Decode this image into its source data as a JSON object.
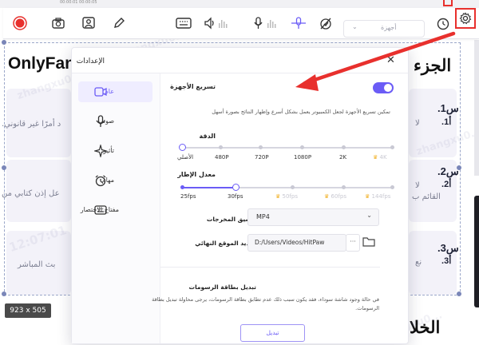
{
  "toolbar": {
    "time_display": "00:00:01  00:00:05",
    "icons": [
      "record-icon",
      "camera-icon",
      "webcam-icon",
      "pen-icon",
      "keyboard-icon",
      "speaker-icon",
      "microphone-icon",
      "wifi-mic-icon",
      "disable-icon",
      "timer-icon",
      "settings-icon"
    ],
    "device_select": {
      "value": "أجهزة",
      "caret": "⌄"
    },
    "colors": {
      "record": "#e8302d",
      "accent": "#6b5cf6"
    }
  },
  "background_page": {
    "heading_top_right": "الجزء",
    "heading_top_left": "OnlyFans",
    "heading_bottom_right": "الخلا",
    "cards_left": [
      "د أمرًا غير قانوني.",
      "عل إذن كتابي من",
      "بث المباشر"
    ],
    "questions": [
      {
        "q": "س1.",
        "a": "أ1.",
        "a_tail": "لا"
      },
      {
        "q": "س2.",
        "a": "أ2.",
        "a_tail": "لا",
        "extra": "القائم ب"
      },
      {
        "q": "س3.",
        "a": "أ3.",
        "a_tail": "نع"
      }
    ],
    "watermark": "zhangxu0...",
    "watermark_time": "12:07:01",
    "size_tag": "923 x 505"
  },
  "dialog": {
    "title": "الإعدادات",
    "close": "✕",
    "nav": [
      {
        "label": "عام",
        "icon": "video-icon",
        "active": true
      },
      {
        "label": "صوتي",
        "icon": "microphone-icon",
        "active": false
      },
      {
        "label": "تأثير",
        "icon": "sparkle-icon",
        "active": false
      },
      {
        "label": "مهام",
        "icon": "alarm-clock-icon",
        "active": false
      },
      {
        "label": "مفتاح الاختصار",
        "icon": "keyboard-icon",
        "active": false
      }
    ],
    "hw_accel": {
      "title": "تسريع الأجهزة",
      "enabled": true,
      "description": "تمكين تسريع الأجهزة لجعل الكمبيوتر يعمل بشكل أسرع وإظهار النتائج بصورة أسهل"
    },
    "resolution": {
      "title": "الدقة",
      "ticks": [
        "الأصلي",
        "480P",
        "720P",
        "1080P",
        "2K",
        "4K"
      ],
      "selected_index": 0,
      "pro_ticks": [
        "4K"
      ]
    },
    "frame_rate": {
      "title": "معدل الإطار",
      "ticks": [
        "25fps",
        "30fps",
        "50fps",
        "60fps",
        "144fps"
      ],
      "selected_index": 1,
      "pro_ticks": [
        "50fps",
        "60fps",
        "144fps"
      ]
    },
    "output_format": {
      "label": "تنسيق المخرجات",
      "value": "MP4",
      "caret": "⌄"
    },
    "output_location": {
      "label": "تحديد الموقع النهائي",
      "value": "D:/Users/Videos/HitPaw",
      "ellipsis": "···"
    },
    "graphics_card": {
      "title": "تبديل بطاقة الرسومات",
      "description_line1": "في حالة وجود شاشة سوداء، فقد يكون سبب ذلك عدم تطابق بطاقة الرسومات، يرجى محاولة تبديل بطاقة",
      "description_line2": "الرسومات.",
      "button": "تبديل"
    }
  }
}
